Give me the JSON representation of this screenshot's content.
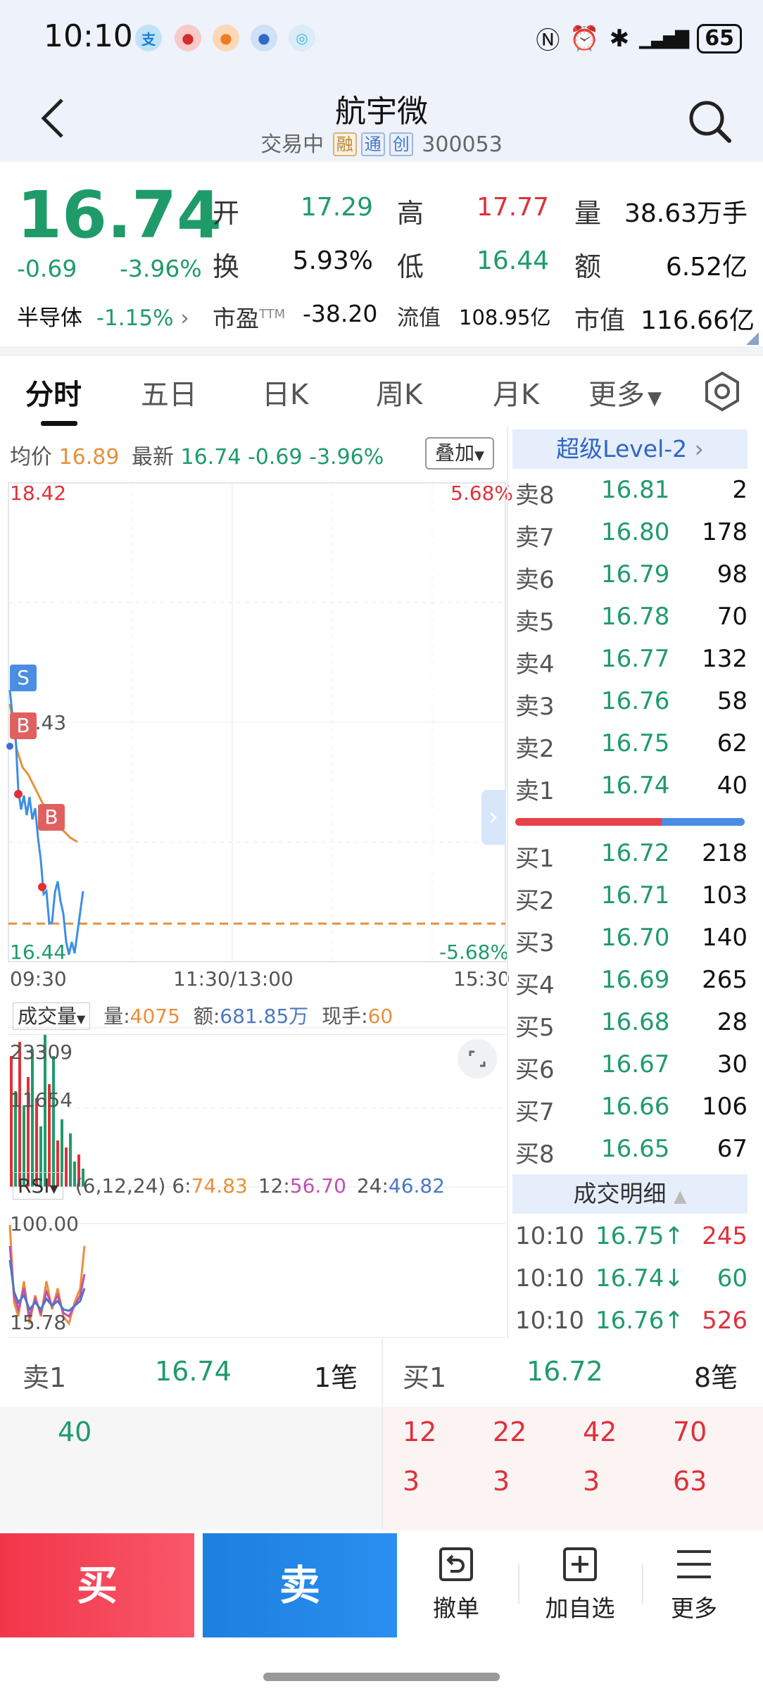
{
  "status": {
    "time": "10:10",
    "battery": "65"
  },
  "header": {
    "name": "航宇微",
    "status": "交易中",
    "tags": [
      "融",
      "通",
      "创"
    ],
    "code": "300053"
  },
  "quote": {
    "price": "16.74",
    "change": "-0.69",
    "pct": "-3.96%",
    "sector_label": "半导体",
    "sector_pct": "-1.15%",
    "open_label": "开",
    "open": "17.29",
    "high_label": "高",
    "high": "17.77",
    "volume_label": "量",
    "volume": "38.63万手",
    "turnover_label": "换",
    "turnover": "5.93%",
    "low_label": "低",
    "low": "16.44",
    "amount_label": "额",
    "amount": "6.52亿",
    "pe_label": "市盈",
    "pe_sup": "TTM",
    "pe": "-38.20",
    "float_label": "流值",
    "float_value": "108.95亿",
    "mcap_label": "市值",
    "mcap": "116.66亿"
  },
  "tabs": [
    "分时",
    "五日",
    "日K",
    "周K",
    "月K",
    "更多"
  ],
  "chart": {
    "avg_label": "均价",
    "avg": "16.89",
    "latest_label": "最新",
    "latest": "16.74",
    "latest_chg": "-0.69",
    "latest_pct": "-3.96%",
    "overlay": "叠加",
    "y_top": "18.42",
    "y_top_pct": "5.68%",
    "y_mid": "17.43",
    "y_bottom": "16.44",
    "y_bottom_pct": "-5.68%",
    "x_labels": [
      "09:30",
      "11:30/13:00",
      "15:30"
    ],
    "markers": [
      "S",
      "B",
      "B"
    ],
    "vol_label": "成交量",
    "vol_q_label": "量:",
    "vol_q": "4075",
    "vol_amt_label": "额:",
    "vol_amt": "681.85万",
    "vol_now_label": "现手:",
    "vol_now": "60",
    "vol_top": "23309",
    "vol_mid": "11654",
    "rsi_label": "RSI",
    "rsi_params": "(6,12,24)",
    "rsi6_label": "6:",
    "rsi6": "74.83",
    "rsi12_label": "12:",
    "rsi12": "56.70",
    "rsi24_label": "24:",
    "rsi24": "46.82",
    "rsi_top": "100.00",
    "rsi_bottom": "15.78"
  },
  "level2": "超级Level-2",
  "asks": [
    {
      "label": "卖8",
      "price": "16.81",
      "vol": "2"
    },
    {
      "label": "卖7",
      "price": "16.80",
      "vol": "178"
    },
    {
      "label": "卖6",
      "price": "16.79",
      "vol": "98"
    },
    {
      "label": "卖5",
      "price": "16.78",
      "vol": "70"
    },
    {
      "label": "卖4",
      "price": "16.77",
      "vol": "132"
    },
    {
      "label": "卖3",
      "price": "16.76",
      "vol": "58"
    },
    {
      "label": "卖2",
      "price": "16.75",
      "vol": "62"
    },
    {
      "label": "卖1",
      "price": "16.74",
      "vol": "40"
    }
  ],
  "bids": [
    {
      "label": "买1",
      "price": "16.72",
      "vol": "218"
    },
    {
      "label": "买2",
      "price": "16.71",
      "vol": "103"
    },
    {
      "label": "买3",
      "price": "16.70",
      "vol": "140"
    },
    {
      "label": "买4",
      "price": "16.69",
      "vol": "265"
    },
    {
      "label": "买5",
      "price": "16.68",
      "vol": "28"
    },
    {
      "label": "买6",
      "price": "16.67",
      "vol": "30"
    },
    {
      "label": "买7",
      "price": "16.66",
      "vol": "106"
    },
    {
      "label": "买8",
      "price": "16.65",
      "vol": "67"
    }
  ],
  "deals_title": "成交明细",
  "deals": [
    {
      "time": "10:10",
      "price": "16.75↑",
      "vol": "245"
    },
    {
      "time": "10:10",
      "price": "16.74↓",
      "vol": "60"
    },
    {
      "time": "10:10",
      "price": "16.76↑",
      "vol": "526"
    }
  ],
  "queue": {
    "ask_label": "卖1",
    "ask_price": "16.74",
    "ask_count": "1笔",
    "ask_orders": [
      "40"
    ],
    "bid_label": "买1",
    "bid_price": "16.72",
    "bid_count": "8笔",
    "bid_orders": [
      "12",
      "22",
      "42",
      "70",
      "3",
      "3",
      "3",
      "63"
    ]
  },
  "actions": {
    "buy": "买",
    "sell": "卖",
    "cancel": "撤单",
    "watch": "加自选",
    "more": "更多"
  }
}
